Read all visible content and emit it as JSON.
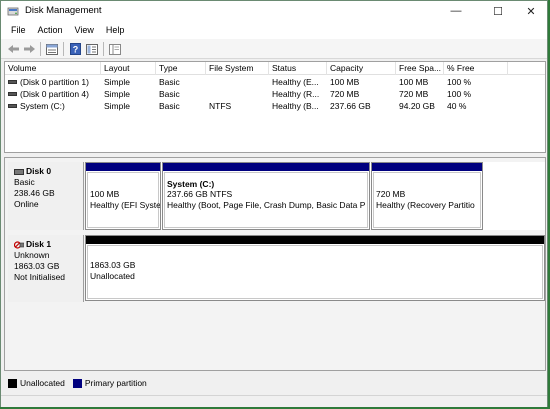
{
  "window": {
    "title": "Disk Management",
    "controls": {
      "minimize": "—",
      "maximize": "☐",
      "close": "✕"
    }
  },
  "menu": [
    "File",
    "Action",
    "View",
    "Help"
  ],
  "toolbar": {
    "icons": [
      "back-arrow-icon",
      "forward-arrow-icon",
      "volume-list-icon",
      "help-icon",
      "properties-icon",
      "console-tree-icon"
    ]
  },
  "volume_list": {
    "columns": [
      "Volume",
      "Layout",
      "Type",
      "File System",
      "Status",
      "Capacity",
      "Free Spa...",
      "% Free"
    ],
    "rows": [
      [
        "(Disk 0 partition 1)",
        "Simple",
        "Basic",
        "",
        "Healthy (E...",
        "100 MB",
        "100 MB",
        "100 %"
      ],
      [
        "(Disk 0 partition 4)",
        "Simple",
        "Basic",
        "",
        "Healthy (R...",
        "720 MB",
        "720 MB",
        "100 %"
      ],
      [
        "System (C:)",
        "Simple",
        "Basic",
        "NTFS",
        "Healthy (B...",
        "237.66 GB",
        "94.20 GB",
        "40 %"
      ]
    ]
  },
  "disks": [
    {
      "name": "Disk 0",
      "type": "Basic",
      "size": "238.46 GB",
      "status": "Online",
      "partitions": [
        {
          "title": "",
          "size": "100 MB",
          "status": "Healthy (EFI Syste"
        },
        {
          "title": "System  (C:)",
          "size": "237.66 GB NTFS",
          "status": "Healthy (Boot, Page File, Crash Dump, Basic Data P"
        },
        {
          "title": "",
          "size": "720 MB",
          "status": "Healthy (Recovery Partitio"
        }
      ]
    },
    {
      "name": "Disk 1",
      "type": "Unknown",
      "size": "1863.03 GB",
      "status": "Not Initialised",
      "partitions": [
        {
          "title": "",
          "size": "1863.03 GB",
          "status": "Unallocated"
        }
      ]
    }
  ],
  "legend": [
    {
      "label": "Unallocated",
      "color": "#000000"
    },
    {
      "label": "Primary partition",
      "color": "#00007f"
    }
  ],
  "colors": {
    "primary": "#00007f",
    "unallocated": "#000000",
    "disk_warning": "#c00000"
  }
}
